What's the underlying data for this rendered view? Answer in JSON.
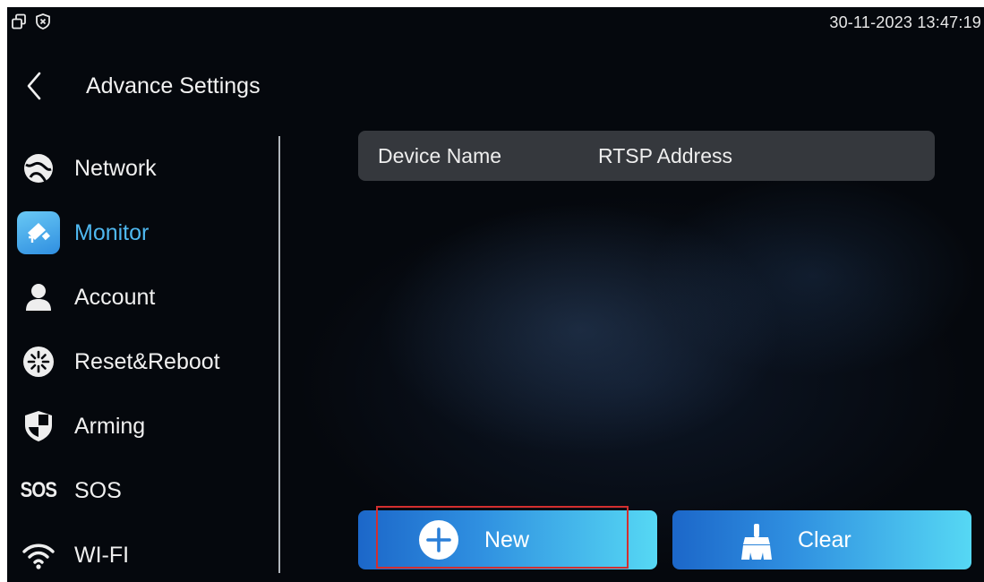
{
  "status_bar": {
    "datetime": "30-11-2023 13:47:19",
    "icons": [
      "window-restore-icon",
      "shield-x-icon"
    ]
  },
  "header": {
    "back_icon": "chevron-left-icon",
    "title": "Advance Settings"
  },
  "sidebar": {
    "items": [
      {
        "label": "Network",
        "icon": "network-icon",
        "active": false
      },
      {
        "label": "Monitor",
        "icon": "monitor-icon",
        "active": true
      },
      {
        "label": "Account",
        "icon": "account-icon",
        "active": false
      },
      {
        "label": "Reset&Reboot",
        "icon": "reset-icon",
        "active": false
      },
      {
        "label": "Arming",
        "icon": "shield-icon",
        "active": false
      },
      {
        "label": "SOS",
        "icon": "sos-icon",
        "icon_text": "SOS",
        "active": false
      },
      {
        "label": "WI-FI",
        "icon": "wifi-icon",
        "active": false
      }
    ]
  },
  "table": {
    "columns": [
      "Device Name",
      "RTSP Address"
    ],
    "rows": []
  },
  "actions": {
    "new_label": "New",
    "clear_label": "Clear"
  },
  "colors": {
    "accent": "#4fb8f0",
    "button_gradient_start": "#1c67c9",
    "button_gradient_end": "#56d8f4",
    "header_bg": "#35383d",
    "highlight": "#d32f2f"
  }
}
